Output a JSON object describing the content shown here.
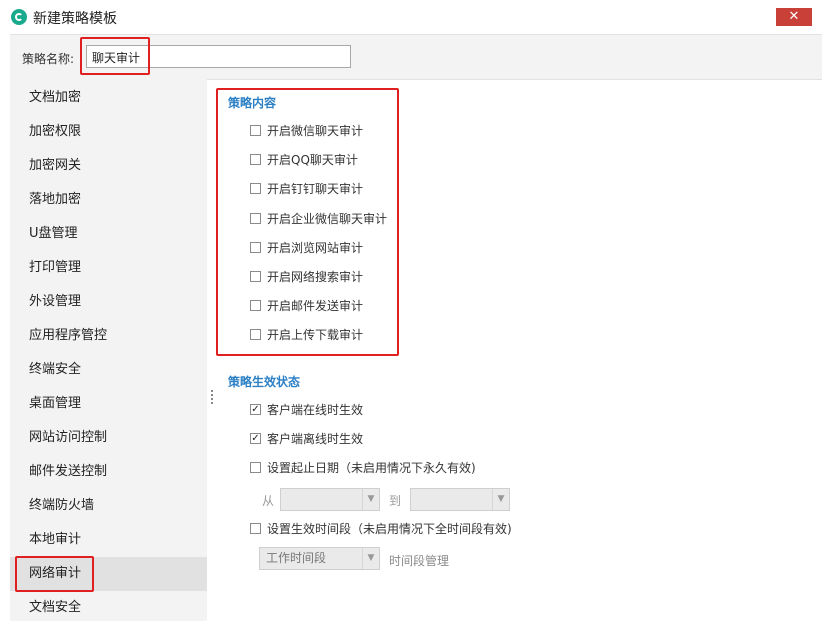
{
  "window": {
    "title": "新建策略模板",
    "close_symbol": "✕"
  },
  "policy_name": {
    "label": "策略名称:",
    "value": "聊天审计"
  },
  "sidebar": {
    "items": [
      {
        "label": "文档加密"
      },
      {
        "label": "加密权限"
      },
      {
        "label": "加密网关"
      },
      {
        "label": "落地加密"
      },
      {
        "label": "U盘管理"
      },
      {
        "label": "打印管理"
      },
      {
        "label": "外设管理"
      },
      {
        "label": "应用程序管控"
      },
      {
        "label": "终端安全"
      },
      {
        "label": "桌面管理"
      },
      {
        "label": "网站访问控制"
      },
      {
        "label": "邮件发送控制"
      },
      {
        "label": "终端防火墙"
      },
      {
        "label": "本地审计"
      },
      {
        "label": "网络审计"
      },
      {
        "label": "文档安全"
      }
    ],
    "active_item": "网络审计"
  },
  "policy_content": {
    "title": "策略内容",
    "options": [
      {
        "label": "开启微信聊天审计",
        "checked": false
      },
      {
        "label": "开启QQ聊天审计",
        "checked": false
      },
      {
        "label": "开启钉钉聊天审计",
        "checked": false
      },
      {
        "label": "开启企业微信聊天审计",
        "checked": false
      },
      {
        "label": "开启浏览网站审计",
        "checked": false
      },
      {
        "label": "开启网络搜索审计",
        "checked": false
      },
      {
        "label": "开启邮件发送审计",
        "checked": false
      },
      {
        "label": "开启上传下载审计",
        "checked": false
      }
    ]
  },
  "effective_state": {
    "title": "策略生效状态",
    "online": {
      "label": "客户端在线时生效",
      "checked": true
    },
    "offline": {
      "label": "客户端离线时生效",
      "checked": true
    },
    "date_range": {
      "label": "设置起止日期（未启用情况下永久有效)",
      "checked": false,
      "from_label": "从",
      "to_label": "到",
      "from_value": "",
      "to_value": ""
    },
    "time_period": {
      "label": "设置生效时间段（未启用情况下全时间段有效)",
      "checked": false,
      "select_value": "工作时间段",
      "manage_label": "时间段管理"
    }
  },
  "colors": {
    "accent_title": "#2c80c5",
    "highlight_border": "#e02020",
    "close_button": "#c94038",
    "app_icon": "#19a98c"
  }
}
